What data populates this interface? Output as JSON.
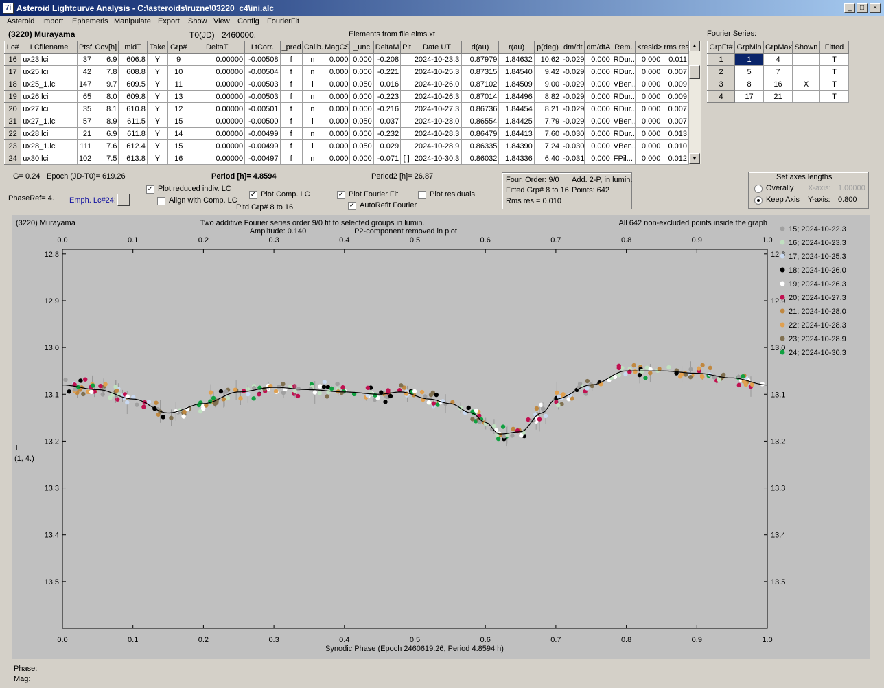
{
  "window": {
    "title": "Asteroid Lightcurve Analysis - C:\\asteroids\\ruzne\\03220_c4\\ini.alc",
    "icon_text": "7i",
    "icon": "app-icon",
    "min_icon": "minimize-icon",
    "max_icon": "maximize-icon",
    "close_icon": "close-icon"
  },
  "menu": [
    "Asteroid",
    "Import",
    "Ephemeris",
    "Manipulate",
    "Export",
    "Show",
    "View",
    "Config",
    "FourierFit"
  ],
  "header": {
    "asteroid": "(3220) Murayama",
    "t0": "T0(JD)= 2460000.",
    "elements": "Elements from file elms.xt",
    "fourier_series": "Fourier Series:"
  },
  "lc_table": {
    "columns": [
      "Lc#",
      "LCfilename",
      "Ptsf",
      "Cov[h]",
      "midT",
      "Take",
      "Grp#",
      "DeltaT",
      "LtCorr.",
      "_pred.",
      "Calib.",
      "MagCS",
      "_unc",
      "DeltaM",
      "Plt",
      "Date UT",
      "d(au)",
      "r(au)",
      "p(deg)",
      "dm/dt",
      "dm/dtA",
      "Rem.",
      "<resid>",
      "rms res"
    ],
    "rows": [
      [
        "16",
        "ux23.lci",
        "37",
        "6.9",
        "606.8",
        "Y",
        "9",
        "0.00000",
        "-0.00508",
        "f",
        "n",
        "0.000",
        "0.000",
        "-0.208",
        "",
        "2024-10-23.3",
        "0.87979",
        "1.84632",
        "10.62",
        "-0.029",
        "0.000",
        "RDur...",
        "0.000",
        "0.011"
      ],
      [
        "17",
        "ux25.lci",
        "42",
        "7.8",
        "608.8",
        "Y",
        "10",
        "0.00000",
        "-0.00504",
        "f",
        "n",
        "0.000",
        "0.000",
        "-0.221",
        "",
        "2024-10-25.3",
        "0.87315",
        "1.84540",
        "9.42",
        "-0.029",
        "0.000",
        "RDur...",
        "0.000",
        "0.007"
      ],
      [
        "18",
        "ux25_1.lci",
        "147",
        "9.7",
        "609.5",
        "Y",
        "11",
        "0.00000",
        "-0.00503",
        "f",
        "i",
        "0.000",
        "0.050",
        "0.016",
        "",
        "2024-10-26.0",
        "0.87102",
        "1.84509",
        "9.00",
        "-0.029",
        "0.000",
        "VBen...",
        "0.000",
        "0.009"
      ],
      [
        "19",
        "ux26.lci",
        "65",
        "8.0",
        "609.8",
        "Y",
        "13",
        "0.00000",
        "-0.00503",
        "f",
        "n",
        "0.000",
        "0.000",
        "-0.223",
        "",
        "2024-10-26.3",
        "0.87014",
        "1.84496",
        "8.82",
        "-0.029",
        "0.000",
        "RDur...",
        "0.000",
        "0.009"
      ],
      [
        "20",
        "ux27.lci",
        "35",
        "8.1",
        "610.8",
        "Y",
        "12",
        "0.00000",
        "-0.00501",
        "f",
        "n",
        "0.000",
        "0.000",
        "-0.216",
        "",
        "2024-10-27.3",
        "0.86736",
        "1.84454",
        "8.21",
        "-0.029",
        "0.000",
        "RDur...",
        "0.000",
        "0.007"
      ],
      [
        "21",
        "ux27_1.lci",
        "57",
        "8.9",
        "611.5",
        "Y",
        "15",
        "0.00000",
        "-0.00500",
        "f",
        "i",
        "0.000",
        "0.050",
        "0.037",
        "",
        "2024-10-28.0",
        "0.86554",
        "1.84425",
        "7.79",
        "-0.029",
        "0.000",
        "VBen...",
        "0.000",
        "0.007"
      ],
      [
        "22",
        "ux28.lci",
        "21",
        "6.9",
        "611.8",
        "Y",
        "14",
        "0.00000",
        "-0.00499",
        "f",
        "n",
        "0.000",
        "0.000",
        "-0.232",
        "",
        "2024-10-28.3",
        "0.86479",
        "1.84413",
        "7.60",
        "-0.030",
        "0.000",
        "RDur...",
        "0.000",
        "0.013"
      ],
      [
        "23",
        "ux28_1.lci",
        "111",
        "7.6",
        "612.4",
        "Y",
        "15",
        "0.00000",
        "-0.00499",
        "f",
        "i",
        "0.000",
        "0.050",
        "0.029",
        "",
        "2024-10-28.9",
        "0.86335",
        "1.84390",
        "7.24",
        "-0.030",
        "0.000",
        "VBen...",
        "0.000",
        "0.010"
      ],
      [
        "24",
        "ux30.lci",
        "102",
        "7.5",
        "613.8",
        "Y",
        "16",
        "0.00000",
        "-0.00497",
        "f",
        "n",
        "0.000",
        "0.000",
        "-0.071",
        "[ ]",
        "2024-10-30.3",
        "0.86032",
        "1.84336",
        "6.40",
        "-0.031",
        "0.000",
        "FPil...",
        "0.000",
        "0.012"
      ]
    ]
  },
  "fourier_table": {
    "columns": [
      "GrpFt#",
      "GrpMin",
      "GrpMax",
      "Shown",
      "Fitted"
    ],
    "rows": [
      [
        "1",
        "1",
        "4",
        "",
        "T"
      ],
      [
        "2",
        "5",
        "7",
        "",
        "T"
      ],
      [
        "3",
        "8",
        "16",
        "X",
        "T"
      ],
      [
        "4",
        "17",
        "21",
        "",
        "T"
      ]
    ]
  },
  "controls": {
    "g": "G= 0.24",
    "epoch": "Epoch (JD-T0)= 619.26",
    "period": "Period [h]= 4.8594",
    "period2": "Period2 [h]= 26.87",
    "phaseref": "PhaseRef= 4.",
    "emph": "Emph. Lc#24:",
    "plot_reduced": "Plot reduced indiv. LC",
    "align": "Align with Comp. LC",
    "plot_comp": "Plot Comp. LC",
    "pltd": "Pltd Grp#  8  to  16",
    "plot_fourier": "Plot Fourier Fit",
    "autorefit": "AutoRefit Fourier",
    "plot_resid": "Plot residuals",
    "info": [
      "Four. Order:  9/0",
      "Add. 2-P, in lumin.",
      "Fitted Grp# 8 to 16",
      "Points: 642",
      "Rms res      = 0.010"
    ],
    "axes_title": "Set axes lengths",
    "overally": "Overally",
    "keep_axis": "Keep Axis",
    "xaxis_label": "X-axis:",
    "xaxis_val": "1.00000",
    "yaxis_label": "Y-axis:",
    "yaxis_val": "0.800"
  },
  "status": {
    "phase": "Phase:",
    "mag": "Mag:"
  },
  "chart_data": {
    "type": "scatter",
    "title_left": "(3220) Murayama",
    "title": "Two additive Fourier series order 9/0 fit to selected groups in lumin.",
    "subtitle_amp": "Amplitude: 0.140",
    "subtitle_p2": "P2-component removed in plot",
    "title_right": "All 642 non-excluded points inside the graph",
    "xlabel": "Synodic Phase (Epoch 2460619.26, Period 4.8594 h)",
    "ylabel": "i",
    "ylabel2": "(1, 4.)",
    "xlim": [
      0,
      1
    ],
    "ylim": [
      13.6,
      12.79
    ],
    "x_ticks": [
      "0.0",
      "0.1",
      "0.2",
      "0.3",
      "0.4",
      "0.5",
      "0.6",
      "0.7",
      "0.8",
      "0.9",
      "1.0"
    ],
    "y_ticks": [
      "12.8",
      "12.9",
      "13.0",
      "13.1",
      "13.2",
      "13.3",
      "13.4",
      "13.5"
    ],
    "fit_curve": [
      [
        0.0,
        13.08
      ],
      [
        0.05,
        13.09
      ],
      [
        0.1,
        13.11
      ],
      [
        0.15,
        13.14
      ],
      [
        0.2,
        13.12
      ],
      [
        0.25,
        13.095
      ],
      [
        0.3,
        13.085
      ],
      [
        0.35,
        13.09
      ],
      [
        0.4,
        13.095
      ],
      [
        0.45,
        13.1
      ],
      [
        0.48,
        13.095
      ],
      [
        0.52,
        13.11
      ],
      [
        0.55,
        13.12
      ],
      [
        0.58,
        13.14
      ],
      [
        0.6,
        13.16
      ],
      [
        0.62,
        13.185
      ],
      [
        0.65,
        13.18
      ],
      [
        0.68,
        13.14
      ],
      [
        0.7,
        13.11
      ],
      [
        0.75,
        13.08
      ],
      [
        0.8,
        13.05
      ],
      [
        0.85,
        13.05
      ],
      [
        0.9,
        13.055
      ],
      [
        0.95,
        13.065
      ],
      [
        1.0,
        13.08
      ]
    ],
    "series": [
      {
        "name": "15; 2024-10-22.3",
        "color": "#a0a0a0"
      },
      {
        "name": "16; 2024-10-23.3",
        "color": "#c0e0c0"
      },
      {
        "name": "17; 2024-10-25.3",
        "color": "#c8d8f0"
      },
      {
        "name": "18; 2024-10-26.0",
        "color": "#000000"
      },
      {
        "name": "19; 2024-10-26.3",
        "color": "#ffffff"
      },
      {
        "name": "20; 2024-10-27.3",
        "color": "#c01050"
      },
      {
        "name": "21; 2024-10-28.0",
        "color": "#c08840"
      },
      {
        "name": "22; 2024-10-28.3",
        "color": "#e0a050"
      },
      {
        "name": "23; 2024-10-28.9",
        "color": "#807050"
      },
      {
        "name": "24; 2024-10-30.3",
        "color": "#10a040"
      }
    ]
  }
}
